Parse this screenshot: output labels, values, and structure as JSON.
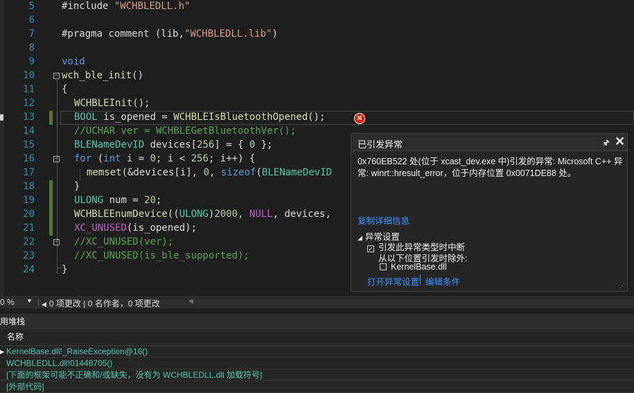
{
  "editor": {
    "lines": [
      {
        "num": "5",
        "tokens": [
          [
            "p",
            "#include "
          ],
          [
            "s",
            "\"WCHBLEDLL.h\""
          ]
        ]
      },
      {
        "num": "6",
        "tokens": []
      },
      {
        "num": "7",
        "tokens": [
          [
            "p",
            "#pragma comment (lib,"
          ],
          [
            "s",
            "\"WCHBLEDLL.lib\""
          ],
          [
            "p",
            ")"
          ]
        ]
      },
      {
        "num": "8",
        "tokens": []
      },
      {
        "num": "9",
        "tokens": [
          [
            "k",
            "void"
          ]
        ]
      },
      {
        "num": "10",
        "tokens": [
          [
            "f",
            "wch_ble_init"
          ],
          [
            "p",
            "()"
          ]
        ]
      },
      {
        "num": "11",
        "tokens": [
          [
            "p",
            "{"
          ]
        ]
      },
      {
        "num": "12",
        "tokens": [
          [
            "f",
            "WCHBLEInit"
          ],
          [
            "p",
            "();"
          ]
        ]
      },
      {
        "num": "13",
        "tokens": [
          [
            "t",
            "BOOL"
          ],
          [
            "p",
            " is_opened = "
          ],
          [
            "f",
            "WCHBLEIsBluetoothOpened"
          ],
          [
            "p",
            "();"
          ]
        ]
      },
      {
        "num": "14",
        "tokens": [
          [
            "c",
            "//UCHAR ver = WCHBLEGetBluetoothVer();"
          ]
        ]
      },
      {
        "num": "15",
        "tokens": [
          [
            "t",
            "BLENameDevID"
          ],
          [
            "p",
            " devices["
          ],
          [
            "n",
            "256"
          ],
          [
            "p",
            "] = { "
          ],
          [
            "n",
            "0"
          ],
          [
            "p",
            " };"
          ]
        ]
      },
      {
        "num": "16",
        "tokens": [
          [
            "k",
            "for"
          ],
          [
            "p",
            " ("
          ],
          [
            "k",
            "int"
          ],
          [
            "p",
            " i = "
          ],
          [
            "n",
            "0"
          ],
          [
            "p",
            "; i < "
          ],
          [
            "n",
            "256"
          ],
          [
            "p",
            "; i++) {"
          ]
        ]
      },
      {
        "num": "17",
        "tokens": [
          [
            "f",
            "memset"
          ],
          [
            "p",
            "(&devices[i], "
          ],
          [
            "n",
            "0"
          ],
          [
            "p",
            ", "
          ],
          [
            "k",
            "sizeof"
          ],
          [
            "p",
            "("
          ],
          [
            "t",
            "BLENameDevID"
          ]
        ]
      },
      {
        "num": "18",
        "tokens": [
          [
            "p",
            "}"
          ]
        ]
      },
      {
        "num": "19",
        "tokens": [
          [
            "t",
            "ULONG"
          ],
          [
            "p",
            " num = "
          ],
          [
            "n",
            "20"
          ],
          [
            "p",
            ";"
          ]
        ]
      },
      {
        "num": "20",
        "tokens": [
          [
            "f",
            "WCHBLEEnumDevice"
          ],
          [
            "p",
            "(("
          ],
          [
            "t",
            "ULONG"
          ],
          [
            "p",
            ")"
          ],
          [
            "n",
            "2000"
          ],
          [
            "p",
            ", "
          ],
          [
            "m",
            "NULL"
          ],
          [
            "p",
            ", devices,"
          ]
        ]
      },
      {
        "num": "21",
        "tokens": [
          [
            "m",
            "XC_UNUSED"
          ],
          [
            "p",
            "(is_opened);"
          ]
        ]
      },
      {
        "num": "22",
        "tokens": [
          [
            "c",
            "//XC_UNUSED(ver);"
          ]
        ]
      },
      {
        "num": "23",
        "tokens": [
          [
            "c",
            "//XC_UNUSED(is_ble_supported);"
          ]
        ]
      },
      {
        "num": "24",
        "tokens": [
          [
            "p",
            "}"
          ]
        ]
      }
    ]
  },
  "exception": {
    "title": "已引发异常",
    "pin_icon": "pin-icon",
    "close_icon": "close-icon",
    "message": "0x760EB522 处(位于 xcast_dev.exe 中)引发的异常: Microsoft C++ 异常: winrt::hresult_error，位于内存位置 0x0071DE88 处。",
    "copy_details": "复制详细信息",
    "settings_header": "异常设置",
    "break_when_thrown": "引发此异常类型时中断",
    "break_when_thrown_checked": true,
    "except_from": "从以下位置引发时除外:",
    "module_name": "KernelBase.dll",
    "module_checked": false,
    "open_settings": "打开异常设置",
    "edit_conditions": "编辑条件"
  },
  "statusbar": {
    "zoom": "0 %",
    "changes": "0 项更改 | 0 名作者，0 项更改"
  },
  "callstack": {
    "title": "用堆栈",
    "column_name": "名称",
    "frames": [
      "KernelBase.dll!_RaiseException@16()",
      "WCHBLEDLL.dll!01448705()",
      "[下面的框架可能不正确和/或缺失，没有为 WCHBLEDLL.dll 加载符号]",
      "[外部代码]"
    ]
  },
  "colors": {
    "keyword": "#569cd6",
    "string": "#d69d85",
    "comment": "#57a64a",
    "type": "#4ec9b0",
    "macro": "#bd63c5",
    "function": "#dcdcaa",
    "number": "#b5cea8",
    "error": "#e51400",
    "link": "#3794ff"
  }
}
